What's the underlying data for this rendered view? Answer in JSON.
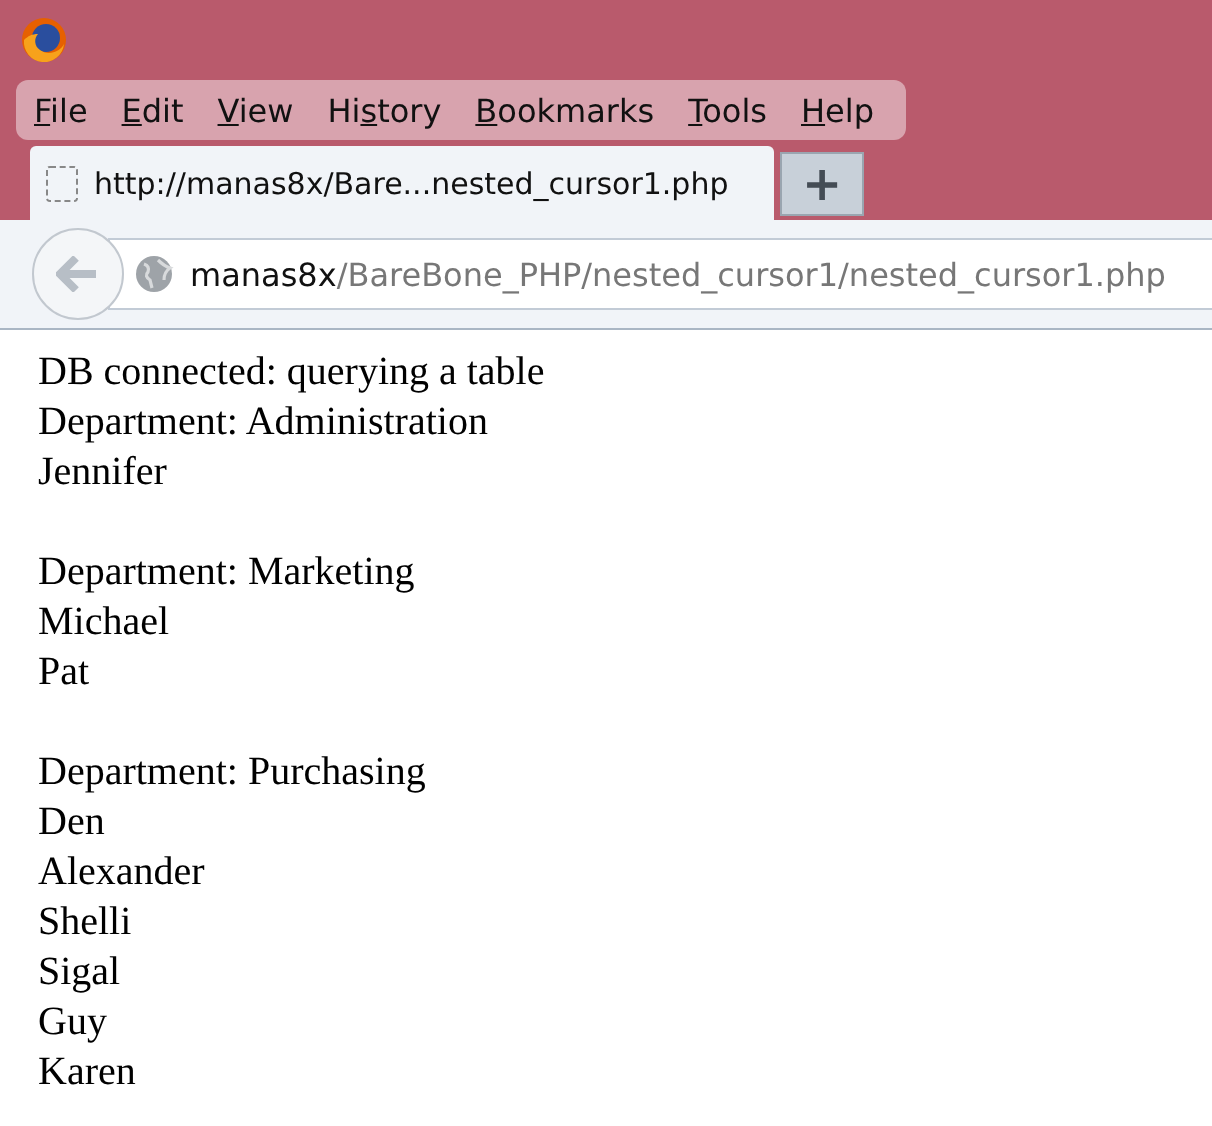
{
  "menu_bar": [
    {
      "key": "F",
      "after": "ile"
    },
    {
      "key": "E",
      "after": "dit"
    },
    {
      "key": "V",
      "after": "iew"
    },
    {
      "before": "Hi",
      "key": "s",
      "after": "tory"
    },
    {
      "key": "B",
      "after": "ookmarks"
    },
    {
      "key": "T",
      "after": "ools"
    },
    {
      "key": "H",
      "after": "elp"
    }
  ],
  "tabs": [
    {
      "title": "http://manas8x/Bare...nested_cursor1.php",
      "selected": true
    }
  ],
  "new_tab_button": "+",
  "address_bar": {
    "host": "manas8x",
    "path": "/BareBone_PHP/nested_cursor1/nested_cursor1.php"
  },
  "page": {
    "status": "DB connected: querying a table",
    "departments": [
      {
        "heading": "Department: Administration",
        "employees": [
          "Jennifer"
        ]
      },
      {
        "heading": "Department: Marketing",
        "employees": [
          "Michael",
          "Pat"
        ]
      },
      {
        "heading": "Department: Purchasing",
        "employees": [
          "Den",
          "Alexander",
          "Shelli",
          "Sigal",
          "Guy",
          "Karen"
        ]
      }
    ]
  }
}
